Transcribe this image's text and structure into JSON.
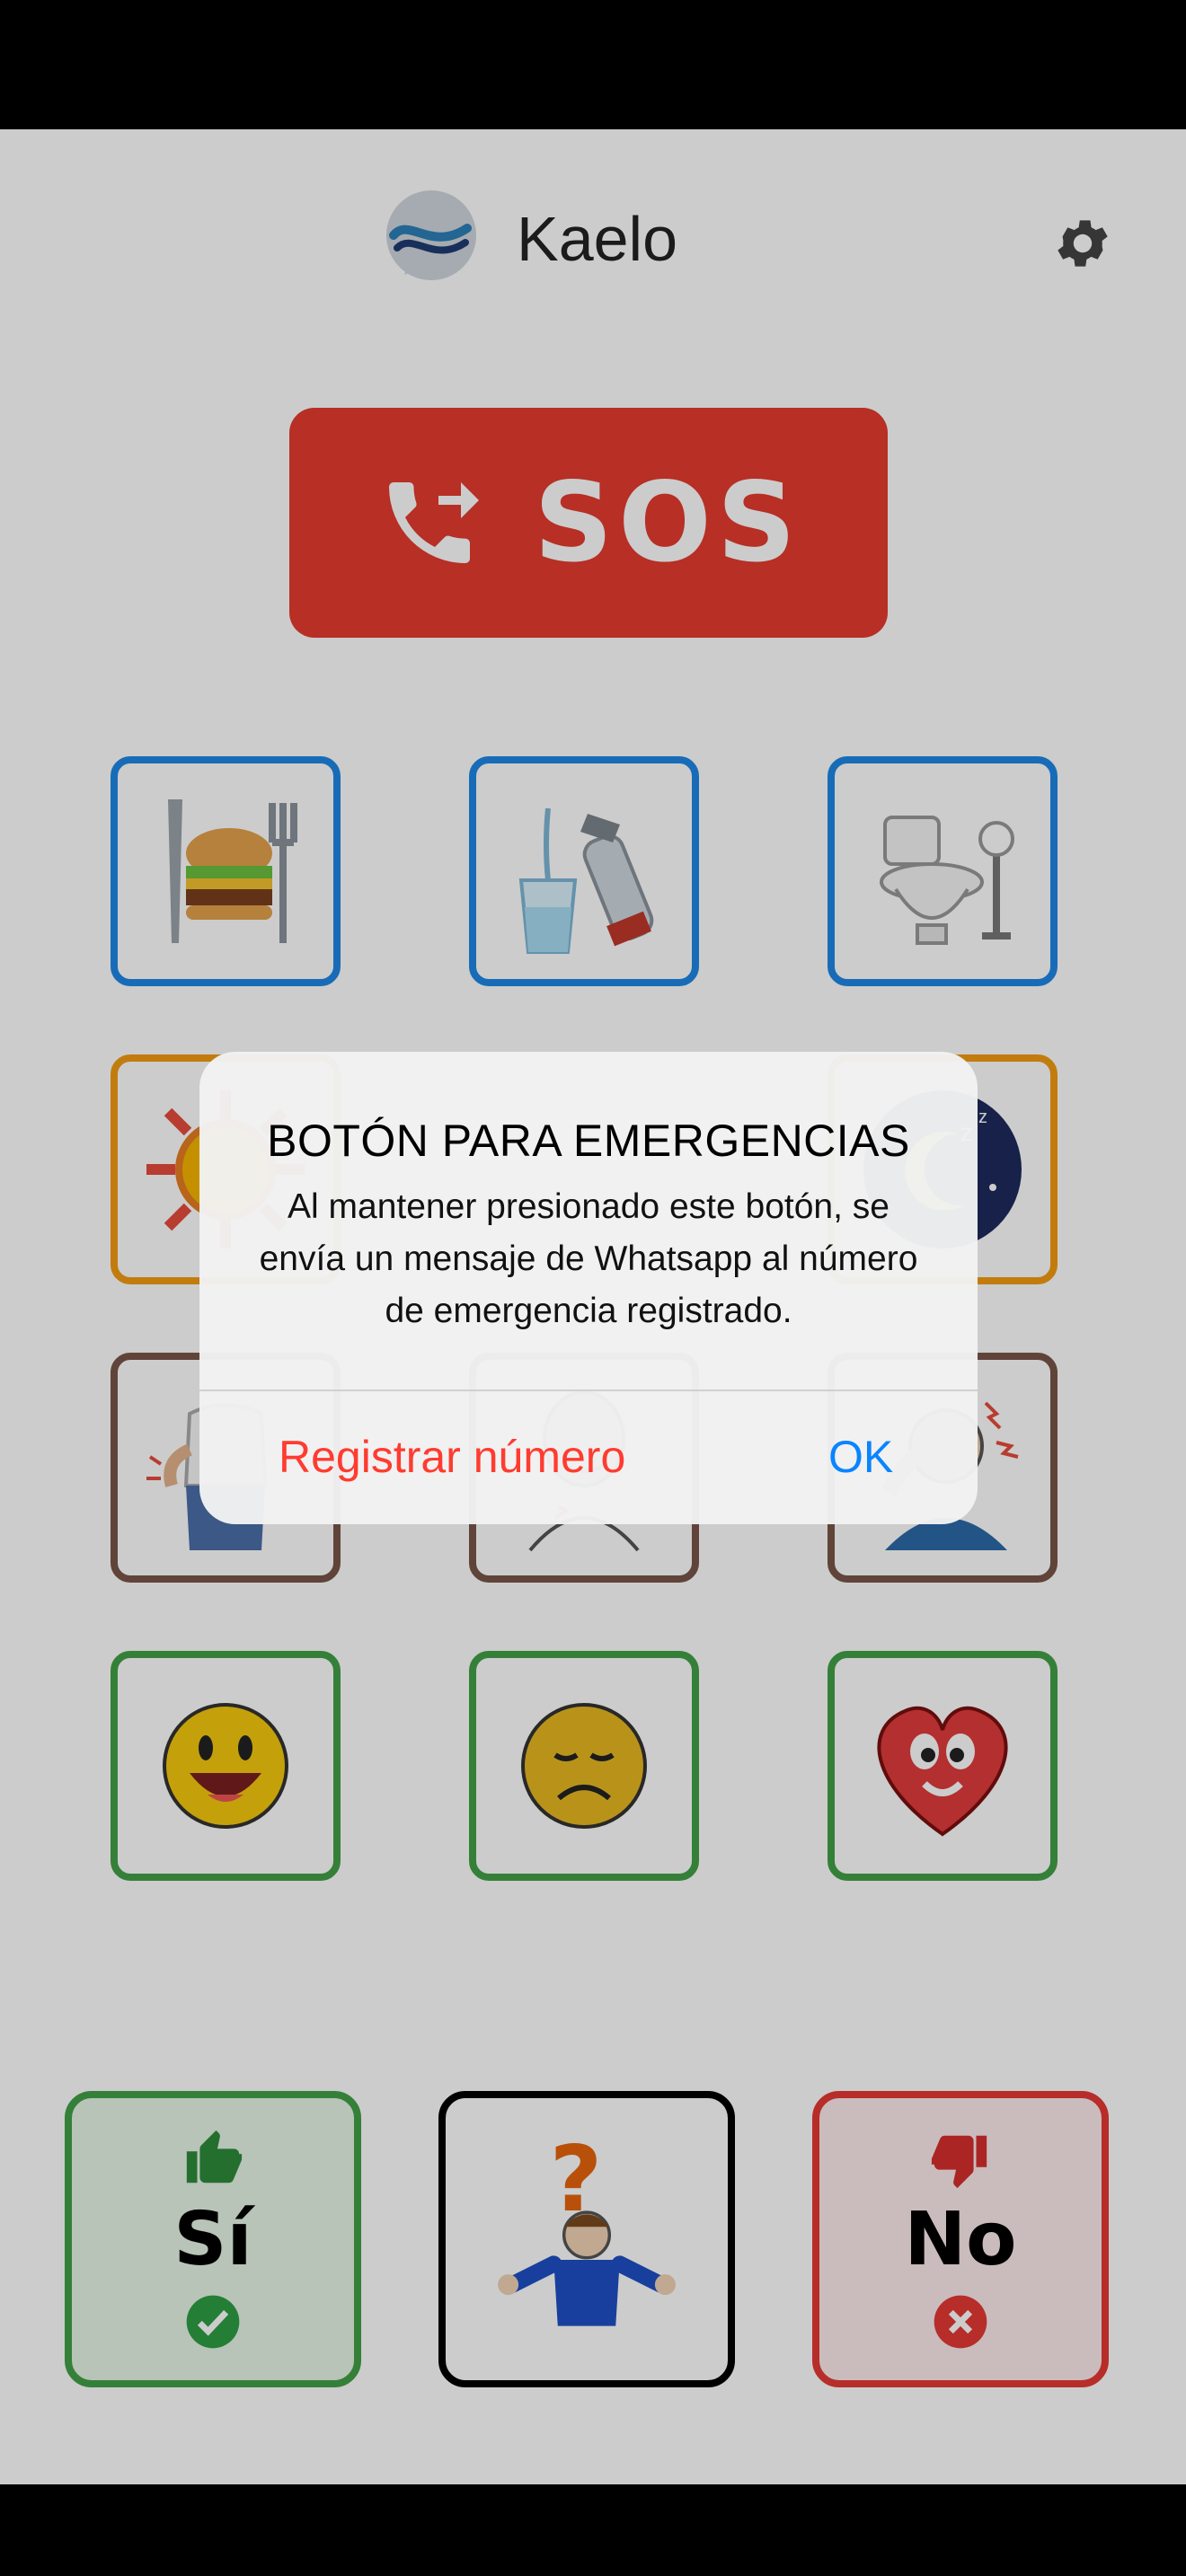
{
  "header": {
    "app_title": "Kaelo",
    "logo_icon": "chat-bubble-wave-logo",
    "settings_icon": "gear-icon"
  },
  "sos": {
    "label": "SOS",
    "icon": "phone-forward-icon",
    "color": "#e53b2f"
  },
  "grid": {
    "rows": [
      {
        "color": "#1e88e5",
        "items": [
          "food-icon",
          "water-icon",
          "toilet-icon"
        ]
      },
      {
        "color": "#f39c12",
        "items": [
          "hot-sun-icon",
          "",
          "night-sleep-icon"
        ]
      },
      {
        "color": "#795548",
        "items": [
          "back-pain-icon",
          "throat-pain-icon",
          "headache-icon"
        ]
      },
      {
        "color": "#43a047",
        "items": [
          "happy-face-icon",
          "sad-face-icon",
          "love-heart-icon"
        ]
      }
    ]
  },
  "answers": {
    "yes": {
      "label": "Sí",
      "icon": "thumbs-up-icon",
      "badge": "check-circle-icon",
      "color": "#43a047"
    },
    "unknown": {
      "icon": "shrug-question-icon"
    },
    "no": {
      "label": "No",
      "icon": "thumbs-down-icon",
      "badge": "x-circle-icon",
      "color": "#e53935"
    }
  },
  "alert": {
    "title": "BOTÓN PARA EMERGENCIAS",
    "message": "Al mantener presionado este botón, se envía un mensaje de Whatsapp al número de emergencia registrado.",
    "register_button": "Registrar número",
    "ok_button": "OK"
  }
}
